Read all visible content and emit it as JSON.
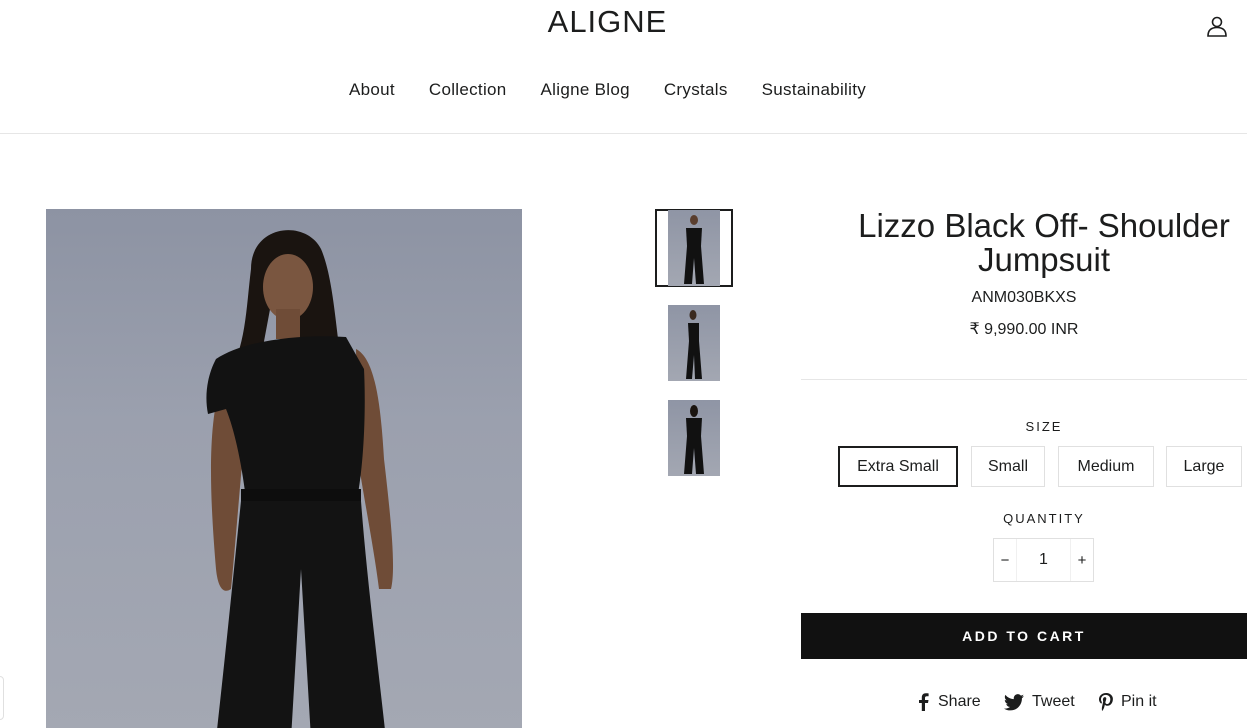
{
  "header": {
    "logo": "ALIGNE",
    "account_icon": "user-icon",
    "nav": [
      "About",
      "Collection",
      "Aligne Blog",
      "Crystals",
      "Sustainability"
    ]
  },
  "product": {
    "title_line1": "Lizzo Black Off- Shoulder",
    "title_line2": "Jumpsuit",
    "sku": "ANM030BKXS",
    "price": "₹ 9,990.00 INR",
    "thumbnails": [
      "front",
      "side",
      "back"
    ],
    "active_thumbnail": 0
  },
  "options": {
    "size_label": "SIZE",
    "sizes": [
      "Extra Small",
      "Small",
      "Medium",
      "Large"
    ],
    "selected_size": "Extra Small",
    "quantity_label": "QUANTITY",
    "quantity": "1",
    "minus": "−",
    "plus": "+"
  },
  "actions": {
    "add_to_cart": "ADD TO CART"
  },
  "social": {
    "share": "Share",
    "tweet": "Tweet",
    "pin": "Pin it"
  },
  "colors": {
    "text": "#1c1d1d",
    "button_bg": "#111111",
    "rule": "#e6e6e6"
  }
}
